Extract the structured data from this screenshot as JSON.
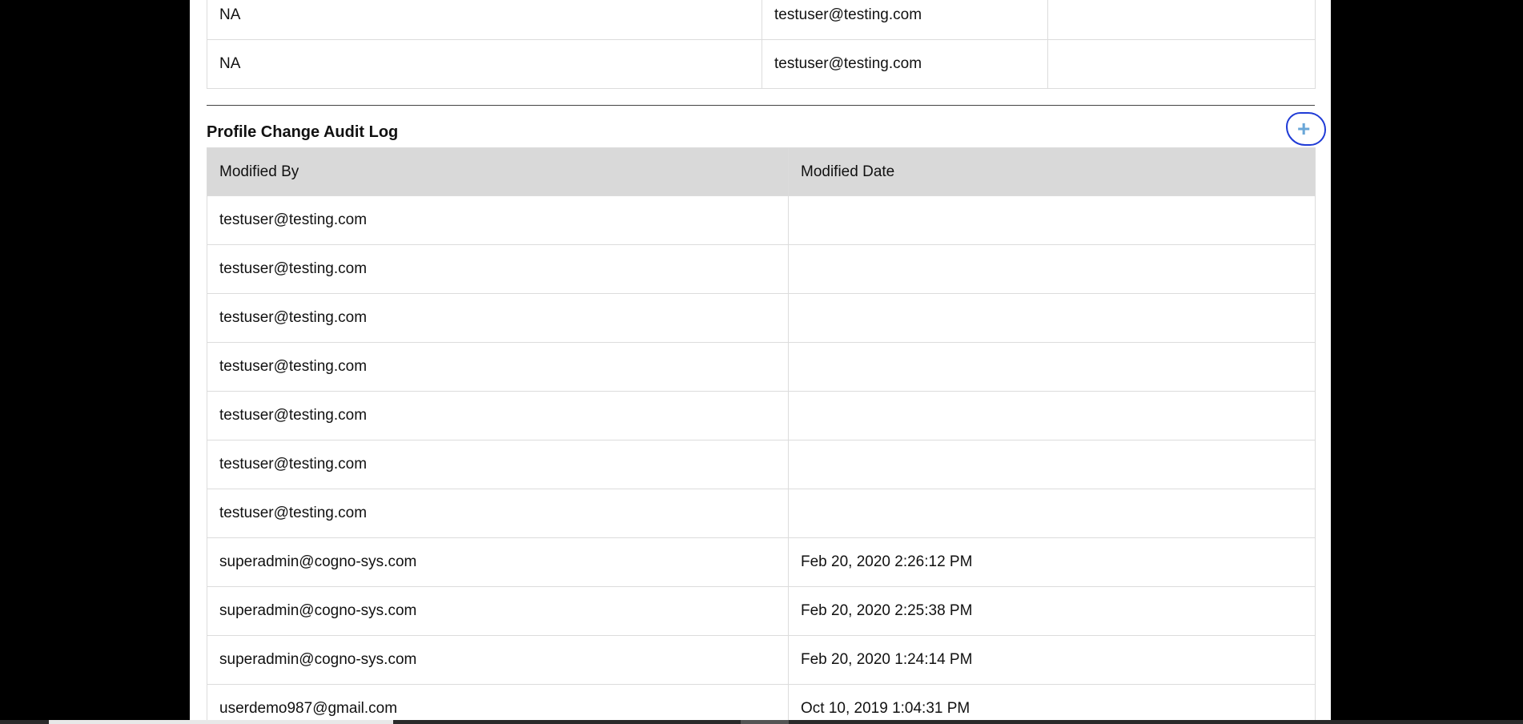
{
  "top_table": {
    "rows": [
      {
        "col1": "NA",
        "col2": "testuser@testing.com",
        "col3": ""
      },
      {
        "col1": "NA",
        "col2": "testuser@testing.com",
        "col3": ""
      }
    ]
  },
  "audit_log": {
    "title": "Profile Change Audit Log",
    "expand_icon": "plus-icon",
    "expand_symbol": "+",
    "columns": [
      "Modified By",
      "Modified Date"
    ],
    "rows": [
      {
        "modified_by": "testuser@testing.com",
        "modified_date": ""
      },
      {
        "modified_by": "testuser@testing.com",
        "modified_date": ""
      },
      {
        "modified_by": "testuser@testing.com",
        "modified_date": ""
      },
      {
        "modified_by": "testuser@testing.com",
        "modified_date": ""
      },
      {
        "modified_by": "testuser@testing.com",
        "modified_date": ""
      },
      {
        "modified_by": "testuser@testing.com",
        "modified_date": ""
      },
      {
        "modified_by": "testuser@testing.com",
        "modified_date": ""
      },
      {
        "modified_by": "superadmin@cogno-sys.com",
        "modified_date": "Feb 20, 2020 2:26:12 PM"
      },
      {
        "modified_by": "superadmin@cogno-sys.com",
        "modified_date": "Feb 20, 2020 2:25:38 PM"
      },
      {
        "modified_by": "superadmin@cogno-sys.com",
        "modified_date": "Feb 20, 2020 1:24:14 PM"
      },
      {
        "modified_by": "userdemo987@gmail.com",
        "modified_date": "Oct 10, 2019 1:04:31 PM"
      }
    ]
  },
  "colors": {
    "header_bg": "#d9d9d9",
    "annotation": "#1f3bd6",
    "plus_icon": "#6aa7d8"
  }
}
